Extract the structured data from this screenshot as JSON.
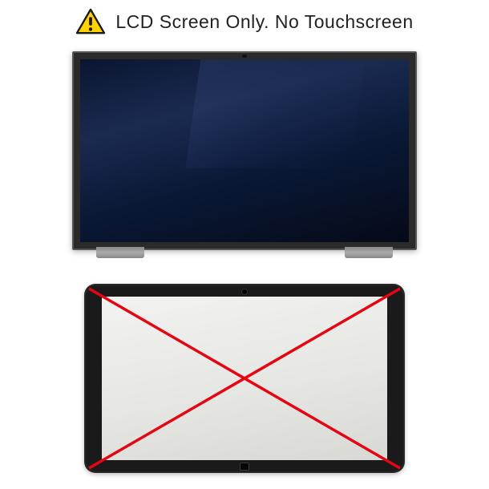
{
  "header": {
    "text": "LCD Screen Only. No Touchscreen"
  },
  "icons": {
    "warning": "warning-triangle"
  },
  "colors": {
    "warning_fill": "#FFD200",
    "warning_border": "#1a1a1a",
    "cross_stroke": "#E30613"
  }
}
